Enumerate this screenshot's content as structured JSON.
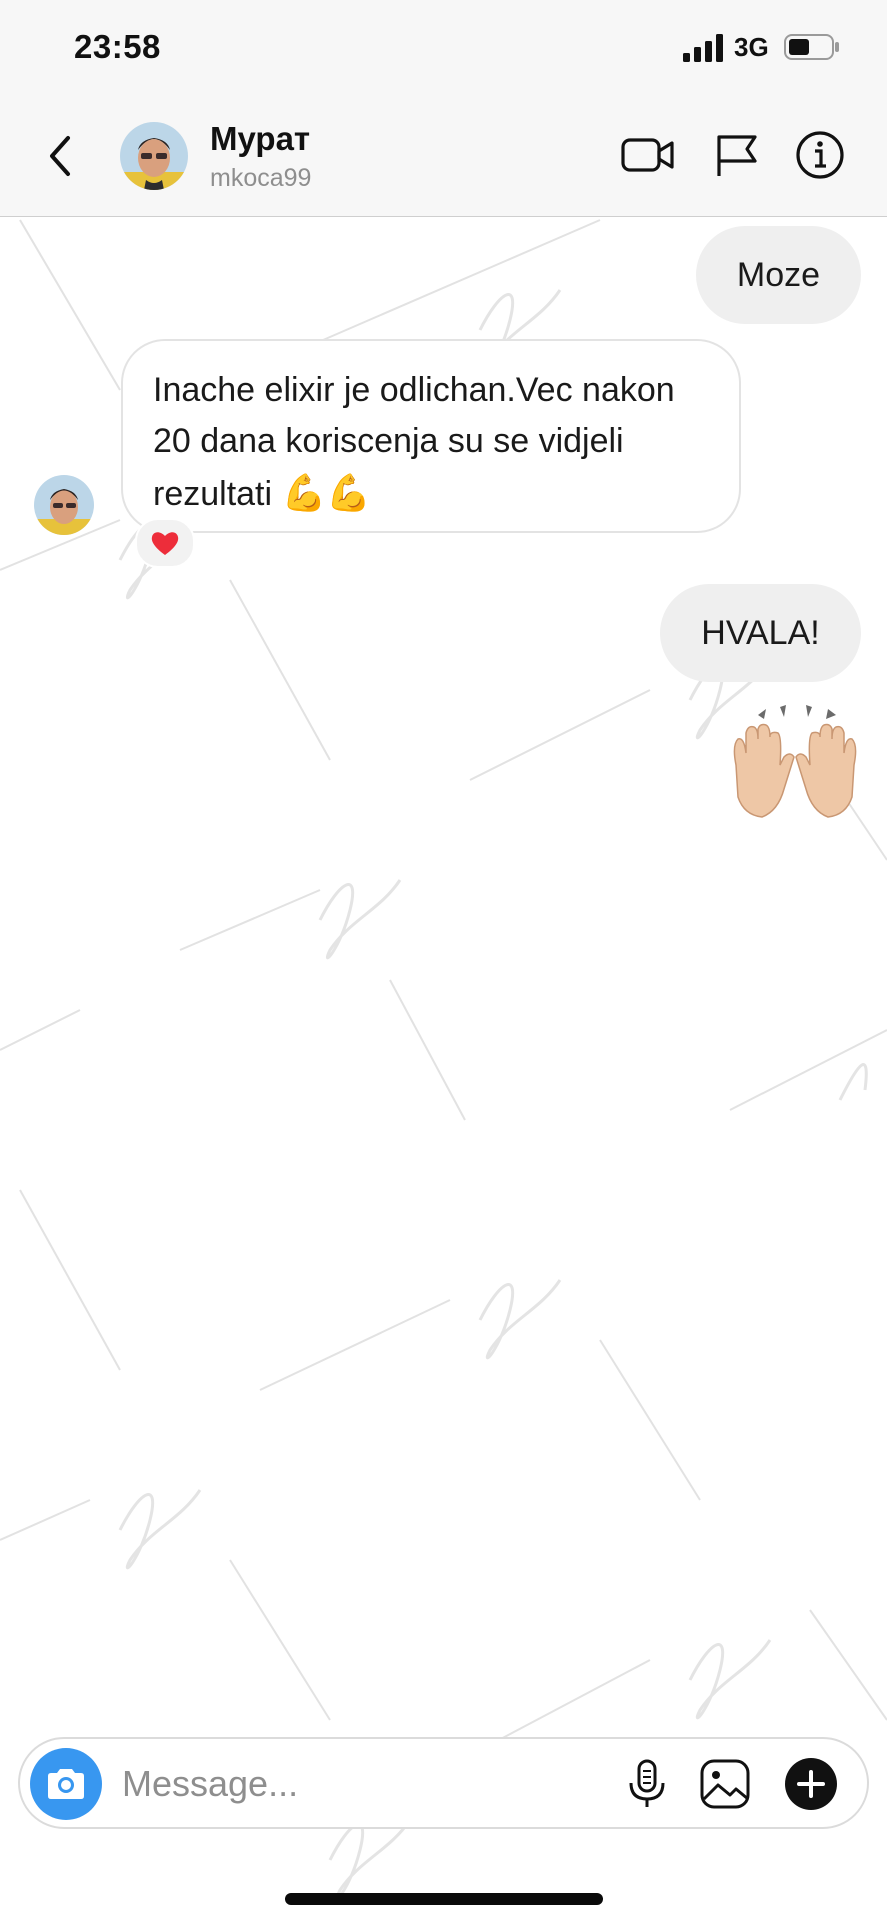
{
  "status_bar": {
    "time": "23:58",
    "network": "3G",
    "battery_level": 0.5
  },
  "header": {
    "contact_name": "Мурат",
    "contact_username": "mkoca99",
    "icons": [
      "back-chevron-icon",
      "video-camera-icon",
      "flag-icon",
      "info-icon"
    ]
  },
  "messages": [
    {
      "sender": "me",
      "text": "Moze"
    },
    {
      "sender": "contact",
      "text": "Inache elixir je odlichan.Vec nakon 20 dana koriscenja su se vidjeli rezultati",
      "emoji": "💪💪",
      "reaction": "heart"
    },
    {
      "sender": "me",
      "text": "HVALA!"
    },
    {
      "sender": "me",
      "emoji": "raised-hands"
    }
  ],
  "composer": {
    "placeholder": "Message...",
    "icons": [
      "camera-icon",
      "microphone-icon",
      "gallery-icon",
      "add-icon"
    ]
  },
  "colors": {
    "accent": "#3897f0",
    "bubble_out": "#efefef",
    "heart": "#ed2d3a"
  }
}
